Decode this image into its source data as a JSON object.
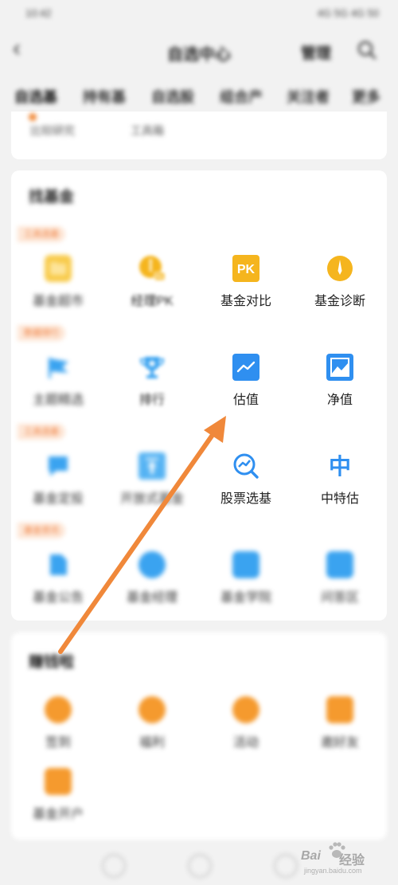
{
  "status_bar": {
    "time": "10:42",
    "right_text": "4G 5G 4G 50"
  },
  "nav": {
    "back_icon": "chevron-left-icon",
    "title": "自选中心",
    "manage_label": "管理",
    "search_icon": "search-icon"
  },
  "tabs": [
    "自选基",
    "持有基",
    "自选股",
    "组合产",
    "关注者",
    "更多"
  ],
  "top_card": {
    "items": [
      "比较研究",
      "工具箱"
    ]
  },
  "main_section": {
    "title": "找基金",
    "rows": [
      {
        "tag": "工具选基",
        "items": [
          {
            "label": "基金超市",
            "icon": "folder-icon",
            "color": "#f7c842",
            "sharp": false
          },
          {
            "label": "经理PK",
            "icon": "manager-pk-icon",
            "color": "#f5b51e",
            "sharp": true
          },
          {
            "label": "基金对比",
            "icon": "pk-icon",
            "color": "#f5b51e",
            "sharp": true
          },
          {
            "label": "基金诊断",
            "icon": "diagnosis-icon",
            "color": "#f5b51e",
            "sharp": true
          }
        ]
      },
      {
        "tag": "数据排行",
        "items": [
          {
            "label": "主题精选",
            "icon": "flag-icon",
            "color": "#3aa3f0",
            "sharp": false
          },
          {
            "label": "排行",
            "icon": "trophy-icon",
            "color": "#3aa3f0",
            "sharp": true
          },
          {
            "label": "估值",
            "icon": "trend-chart-icon",
            "color": "#2f8ff0",
            "sharp": true
          },
          {
            "label": "净值",
            "icon": "mountain-chart-icon",
            "color": "#2f8ff0",
            "sharp": true
          }
        ]
      },
      {
        "tag": "工具选基",
        "items": [
          {
            "label": "基金定投",
            "icon": "chat-icon",
            "color": "#3aa3f0",
            "sharp": false
          },
          {
            "label": "开放式基金",
            "icon": "upload-icon",
            "color": "#3aa3f0",
            "sharp": false
          },
          {
            "label": "股票选基",
            "icon": "stock-search-icon",
            "color": "#2f8ff0",
            "sharp": true
          },
          {
            "label": "中特估",
            "icon": "zhong-icon",
            "color": "#2f8ff0",
            "sharp": true
          }
        ]
      },
      {
        "tag": "基金资讯",
        "items": [
          {
            "label": "基金公告",
            "icon": "document-icon",
            "color": "#3aa3f0",
            "sharp": false
          },
          {
            "label": "基金经理",
            "icon": "circle-icon",
            "color": "#3aa3f0",
            "sharp": false
          },
          {
            "label": "基金学院",
            "icon": "book-icon",
            "color": "#3aa3f0",
            "sharp": false
          },
          {
            "label": "问答区",
            "icon": "clipboard-icon",
            "color": "#3aa3f0",
            "sharp": false
          }
        ]
      }
    ]
  },
  "bottom_section": {
    "title": "赚钱啦",
    "items": [
      {
        "label": "签到",
        "icon": "orange-circle-icon",
        "color": "#f59a2e"
      },
      {
        "label": "福利",
        "icon": "orange-circle-icon",
        "color": "#f59a2e"
      },
      {
        "label": "活动",
        "icon": "orange-circle-icon",
        "color": "#f59a2e"
      },
      {
        "label": "邀好友",
        "icon": "orange-square-icon",
        "color": "#f59a2e"
      },
      {
        "label": "基金开户",
        "icon": "orange-square-icon",
        "color": "#f59a2e"
      }
    ]
  },
  "watermark": {
    "brand_left": "Bai",
    "brand_right": "经验",
    "url": "jingyan.baidu.com"
  },
  "annotation": {
    "color": "#f0883a",
    "points_to": "估值"
  }
}
